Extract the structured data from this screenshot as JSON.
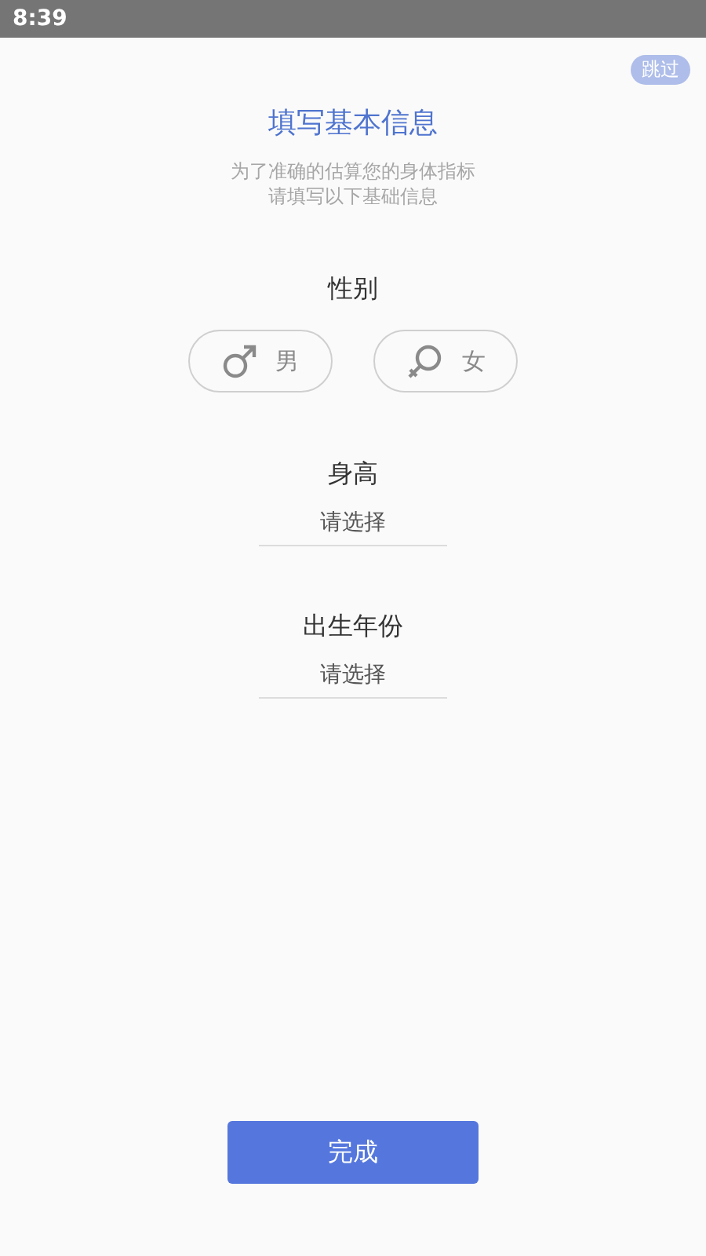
{
  "status_bar": {
    "time": "8:39"
  },
  "skip_button": "跳过",
  "title": "填写基本信息",
  "subtitle_lines": [
    "为了准确的估算您的身体指标",
    "请填写以下基础信息"
  ],
  "gender": {
    "label": "性别",
    "options": [
      {
        "kind": "male",
        "label": "男",
        "selected": false
      },
      {
        "kind": "female",
        "label": "女",
        "selected": false
      }
    ]
  },
  "fields": [
    {
      "label": "身高",
      "placeholder": "请选择"
    },
    {
      "label": "出生年份",
      "placeholder": "请选择"
    }
  ],
  "done_button": "完成"
}
